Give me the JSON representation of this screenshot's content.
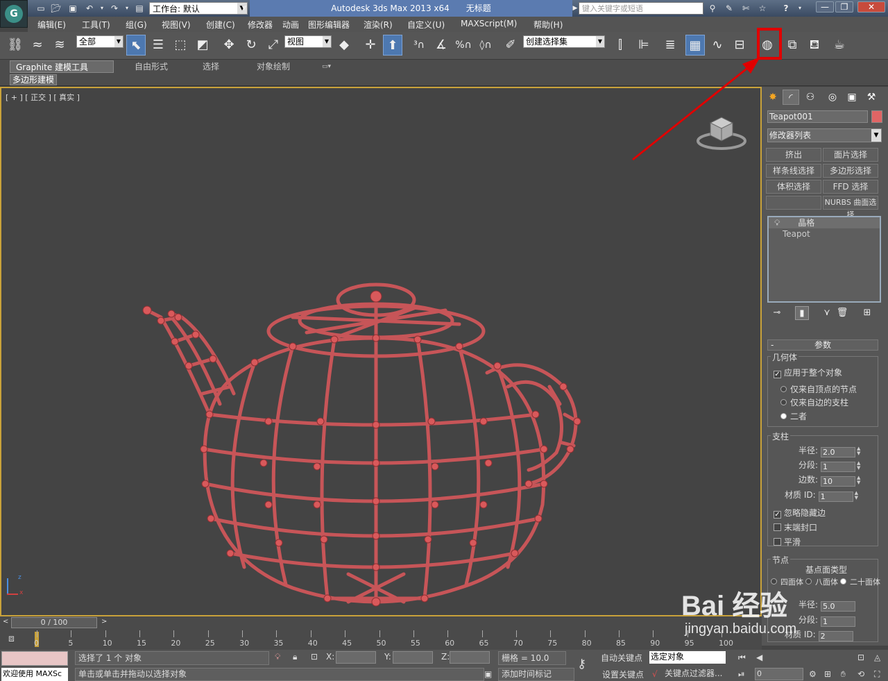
{
  "titlebar": {
    "logo_letter": "G",
    "workspace_label": "工作台: 默认",
    "app_title": "Autodesk 3ds Max  2013 x64",
    "doc_title": "无标题",
    "search_placeholder": "键入关键字或短语",
    "window_buttons": [
      "—",
      "❐",
      "✕"
    ]
  },
  "menubar": {
    "items": [
      "编辑(E)",
      "工具(T)",
      "组(G)",
      "视图(V)",
      "创建(C)",
      "修改器",
      "动画",
      "图形编辑器",
      "渲染(R)",
      "自定义(U)",
      "MAXScript(M)",
      "帮助(H)"
    ]
  },
  "toolbar": {
    "selection_filter": "全部",
    "ref_coord": "视图",
    "named_selection": "创建选择集"
  },
  "ribbon": {
    "tabs": [
      "Graphite 建模工具",
      "自由形式",
      "选择",
      "对象绘制"
    ],
    "subtab": "多边形建模"
  },
  "viewport": {
    "label": "[ + ] [ 正交 ] [ 真实 ]",
    "accent_border": "#c9a23a",
    "object_color": "#d9595b",
    "gizmo_axes": [
      "z",
      "x"
    ]
  },
  "command_panel": {
    "object_name": "Teapot001",
    "object_color": "#e06565",
    "modifier_list": "修改器列表",
    "modifier_buttons": [
      "挤出",
      "面片选择",
      "样条线选择",
      "多边形选择",
      "体积选择",
      "FFD 选择",
      "",
      "NURBS 曲面选择"
    ],
    "stack": {
      "modifier": "晶格",
      "base": "Teapot"
    },
    "rollout_title": "参数",
    "geometry_group": {
      "title": "几何体",
      "apply_whole": "应用于整个对象",
      "options": [
        "仅来自顶点的节点",
        "仅来自边的支柱",
        "二者"
      ]
    },
    "struts_group": {
      "title": "支柱",
      "radius_label": "半径:",
      "radius": "2.0",
      "segments_label": "分段:",
      "segments": "1",
      "sides_label": "边数:",
      "sides": "10",
      "matid_label": "材质 ID:",
      "matid": "1",
      "ignore_hidden": "忽略隐藏边",
      "end_caps": "末端封口",
      "smooth": "平滑"
    },
    "joints_group": {
      "title": "节点",
      "base_type": "基点面类型",
      "types": [
        "四面体",
        "八面体",
        "二十面体"
      ],
      "radius_label": "半径:",
      "radius": "5.0",
      "segments_label": "分段:",
      "segments": "1",
      "matid_label": "材质 ID:",
      "matid": "2"
    }
  },
  "timeline": {
    "slider_label": "0 / 100",
    "ticks": [
      "0",
      "5",
      "10",
      "15",
      "20",
      "25",
      "30",
      "35",
      "40",
      "45",
      "50",
      "55",
      "60",
      "65",
      "70",
      "75",
      "80",
      "85",
      "90",
      "95",
      "100"
    ]
  },
  "statusbar": {
    "selection_status": "选择了 1 个 对象",
    "prompt": "单击或单击并拖动以选择对象",
    "welcome": "欢迎使用 MAXSc",
    "x_label": "X:",
    "y_label": "Y:",
    "z_label": "Z:",
    "grid": "栅格 = 10.0",
    "add_time_tag": "添加时间标记",
    "auto_key": "自动关键点",
    "set_key": "设置关键点",
    "selected_objects": "选定对象",
    "key_filters": "关键点过滤器...",
    "frame": "0"
  },
  "watermark": {
    "brand": "Bai 经验",
    "url": "jingyan.baidu.com"
  }
}
